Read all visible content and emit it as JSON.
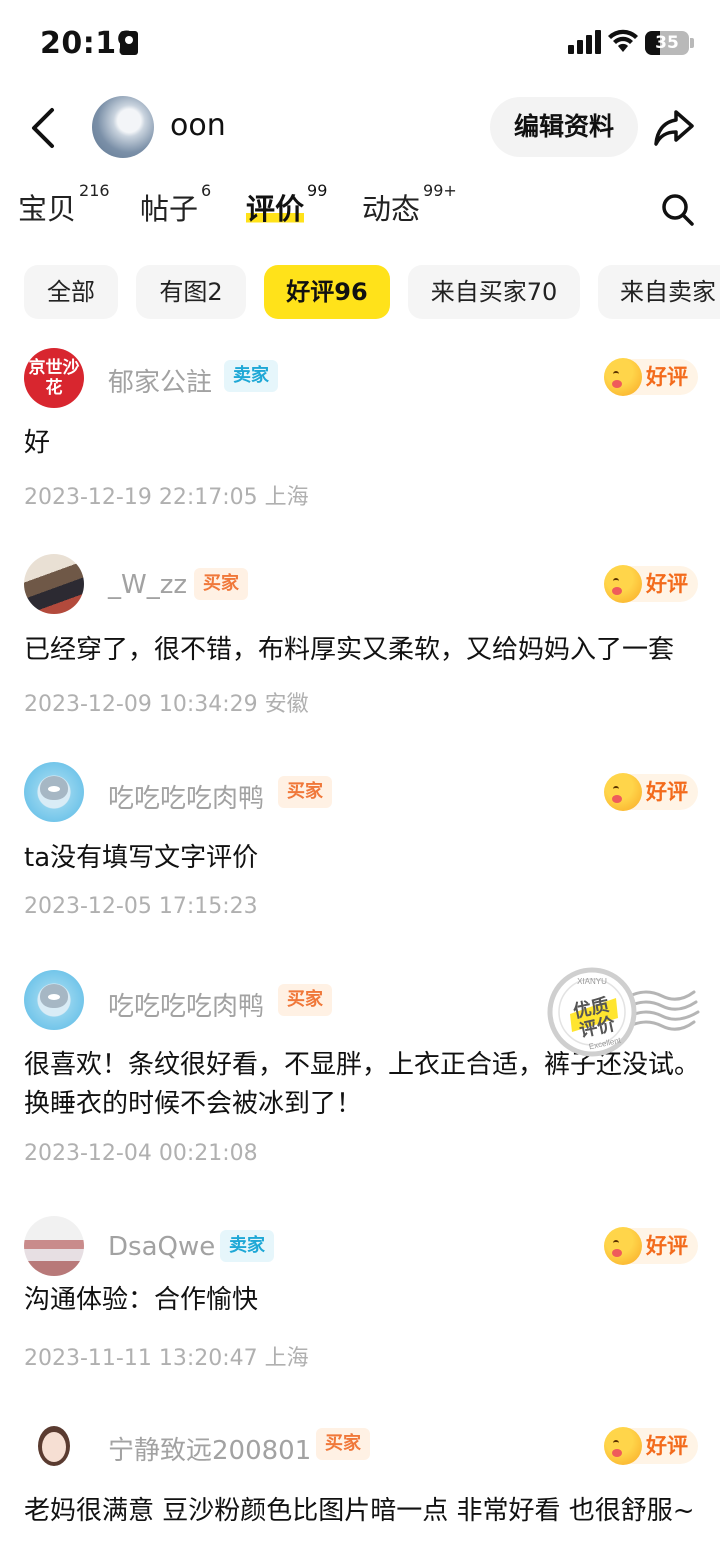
{
  "status_bar": {
    "time": "20:19",
    "battery": "35",
    "battery_level": 0.35
  },
  "header": {
    "username": "oon",
    "edit_label": "编辑资料"
  },
  "tabs": [
    {
      "label": "宝贝",
      "count": "216"
    },
    {
      "label": "帖子",
      "count": "6"
    },
    {
      "label": "评价",
      "count": "99"
    },
    {
      "label": "动态",
      "count": "99+"
    }
  ],
  "active_tab": "评价",
  "filters": [
    "全部",
    "有图2",
    "好评96",
    "来自买家70",
    "来自卖家"
  ],
  "active_filter": "好评96",
  "reviews": [
    {
      "name": "郁家公註",
      "role": "卖家",
      "rating": "好评",
      "text": "好",
      "time": "2023-12-19 22:17:05 上海",
      "avatar_text": "京世沙花"
    },
    {
      "name": "_W_zz",
      "role": "买家",
      "rating": "好评",
      "text": "已经穿了，很不错，布料厚实又柔软，又给妈妈入了一套",
      "time": "2023-12-09 10:34:29 安徽"
    },
    {
      "name": "吃吃吃吃肉鸭",
      "role": "买家",
      "rating": "好评",
      "text": "ta没有填写文字评价",
      "time": "2023-12-05 17:15:23"
    },
    {
      "name": "吃吃吃吃肉鸭",
      "role": "买家",
      "rating": "",
      "text": "很喜欢！条纹很好看，不显胖，上衣正合适，裤子还没试。换睡衣的时候不会被冰到了！",
      "time": "2023-12-04 00:21:08"
    },
    {
      "name": "DsaQwe",
      "role": "卖家",
      "rating": "好评",
      "text": "沟通体验：合作愉快",
      "time": "2023-11-11 13:20:47 上海"
    },
    {
      "name": "宁静致远200801",
      "role": "买家",
      "rating": "好评",
      "text": "老妈很满意 豆沙粉颜色比图片暗一点 非常好看 也很舒服~",
      "time": ""
    }
  ],
  "stamp": {
    "top": "XIANYU",
    "main": "优质评价",
    "bottom": "Excellent"
  },
  "icons": [
    "back-icon",
    "share-icon",
    "search-icon",
    "signal-icon",
    "wifi-icon",
    "battery-icon",
    "id-card-icon",
    "smile-rating-icon"
  ],
  "colors": {
    "accent": "#ffe21a",
    "seller": "#1fa8d6",
    "buyer": "#f0783a",
    "rating": "#f36b1c"
  }
}
